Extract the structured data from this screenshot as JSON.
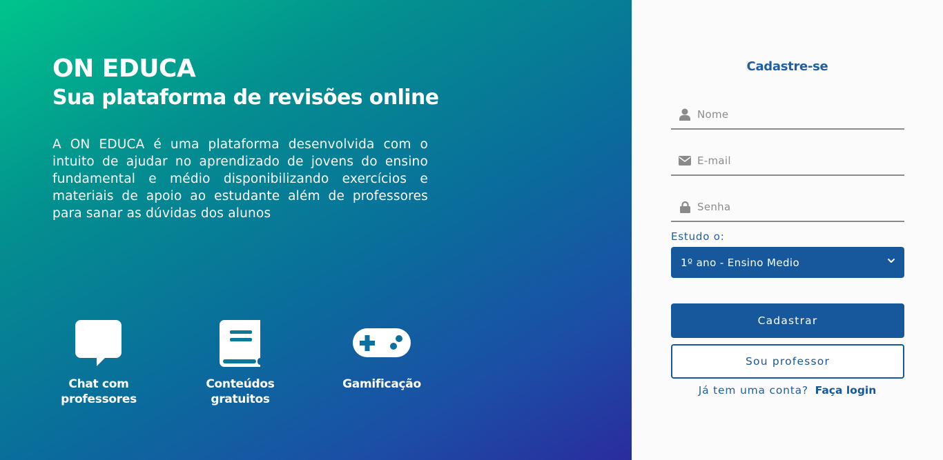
{
  "hero": {
    "brand": "ON EDUCA",
    "tagline": "Sua plataforma de revisões online",
    "description": "A ON EDUCA é uma plataforma desenvolvida com o intuito de ajudar no aprendizado de jovens do ensino fundamental e médio disponibilizando exercícios e materiais de apoio ao estudante além de professores para sanar as dúvidas dos alunos",
    "features": [
      {
        "icon": "chat-bubble-icon",
        "label_line1": "Chat com",
        "label_line2": "professores"
      },
      {
        "icon": "book-icon",
        "label_line1": "Conteúdos",
        "label_line2": "gratuitos"
      },
      {
        "icon": "gamepad-icon",
        "label_line1": "Gamificação",
        "label_line2": ""
      }
    ]
  },
  "signup": {
    "title": "Cadastre-se",
    "name_placeholder": "Nome",
    "email_placeholder": "E-mail",
    "password_placeholder": "Senha",
    "study_label": "Estudo o:",
    "study_selected": "1º ano - Ensino Medio",
    "submit_label": "Cadastrar",
    "teacher_label": "Sou professor",
    "have_account_text": "Já tem uma conta?",
    "login_link": "Faça login"
  },
  "colors": {
    "primary": "#17589c",
    "title_blue": "#1f5fa6",
    "gradient_start": "#00c48c",
    "gradient_end": "#2a2c9e",
    "panel_bg": "#fbfbfb"
  }
}
